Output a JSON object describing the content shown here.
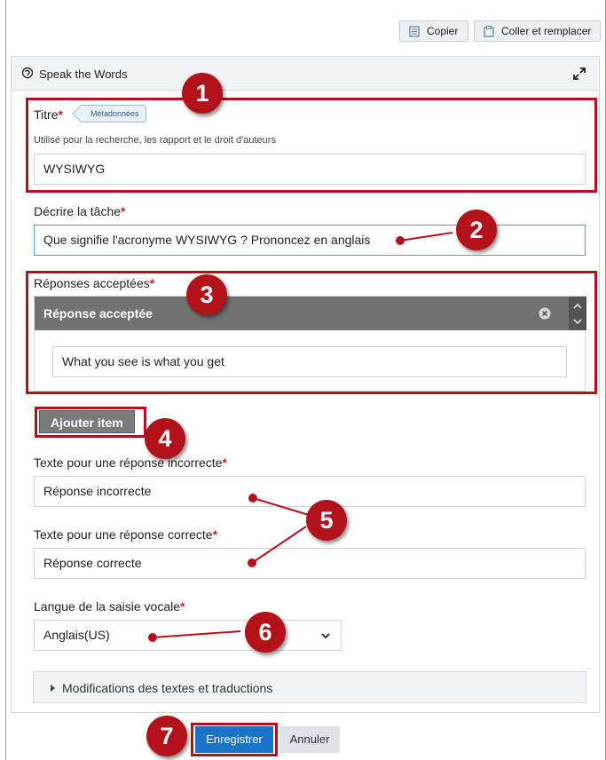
{
  "toolbar": {
    "copy_label": "Copier",
    "paste_replace_label": "Coller et remplacer",
    "copy_icon": "copy-icon",
    "paste_icon": "paste-icon"
  },
  "panel": {
    "title": "Speak the Words",
    "title_icon": "cube-icon",
    "expand_icon": "expand-icon"
  },
  "fields": {
    "title": {
      "label": "Titre",
      "required_mark": "*",
      "meta_tag": "Métadonnées",
      "hint": "Utilisé pour la recherche, les rapport et le droit d'auteurs",
      "value": "WYSIWYG"
    },
    "task": {
      "label": "Décrire la tâche",
      "required_mark": "*",
      "value": "Que signifie l'acronyme WYSIWYG ? Prononcez en anglais"
    },
    "accepted": {
      "label": "Réponses acceptées",
      "required_mark": "*",
      "item_header": "Réponse acceptée",
      "item_value": "What you see is what you get",
      "add_button": "Ajouter item"
    },
    "incorrect": {
      "label": "Texte pour une réponse incorrecte",
      "required_mark": "*",
      "value": "Réponse incorrecte"
    },
    "correct": {
      "label": "Texte pour une réponse correcte",
      "required_mark": "*",
      "value": "Réponse correcte"
    },
    "language": {
      "label": "Langue de la saisie vocale",
      "required_mark": "*",
      "value": "Anglais(US)"
    }
  },
  "details": {
    "label": "Modifications des textes et traductions"
  },
  "actions": {
    "save_label": "Enregistrer",
    "cancel_label": "Annuler"
  },
  "callouts": [
    "1",
    "2",
    "3",
    "4",
    "5",
    "6",
    "7"
  ],
  "colors": {
    "callout": "#b3121a",
    "primary_button": "#1a73c8",
    "list_header": "#727272",
    "required": "#c0272d"
  }
}
